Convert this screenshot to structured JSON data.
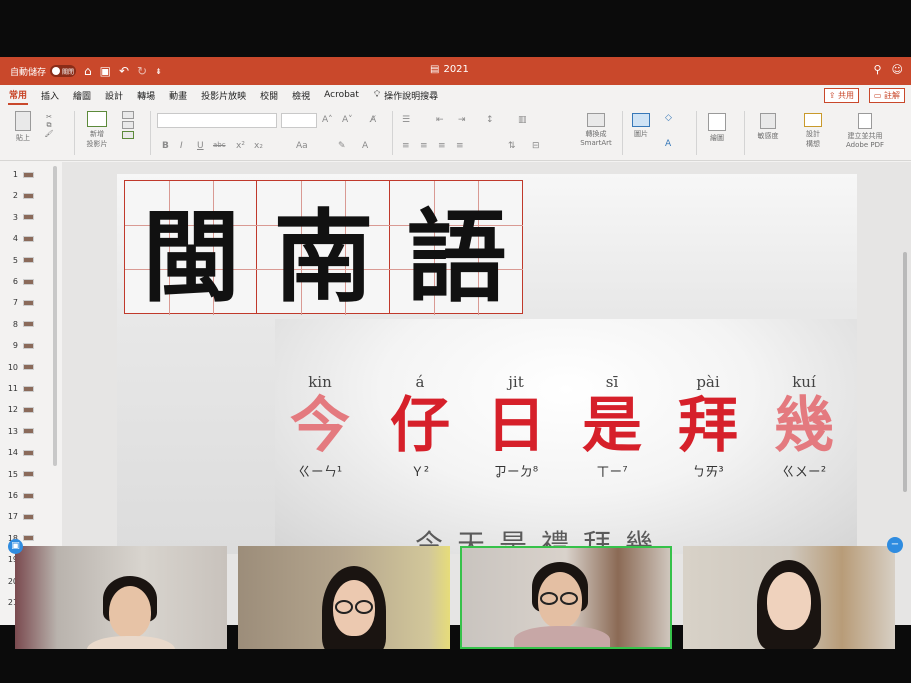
{
  "titlebar": {
    "autosave_label": "自動儲存",
    "autosave_state": "關閉",
    "doc_title": "2021",
    "icons": [
      "home-icon",
      "save-icon",
      "undo-icon",
      "redo-icon",
      "customize-icon",
      "search-icon",
      "person-icon"
    ]
  },
  "menu": {
    "tabs": [
      "常用",
      "插入",
      "繪圖",
      "設計",
      "轉場",
      "動畫",
      "投影片放映",
      "校閱",
      "檢視",
      "Acrobat"
    ],
    "active_tab": "常用",
    "tell_me": "操作說明搜尋",
    "share_label": "共用",
    "comment_label": "註解"
  },
  "ribbon": {
    "paste_label": "貼上",
    "new_slide_label_1": "新增",
    "new_slide_label_2": "投影片",
    "format_buttons": [
      "B",
      "I",
      "U",
      "abc",
      "x²",
      "x₂",
      "Aa"
    ],
    "smartart_label_1": "轉換成",
    "smartart_label_2": "SmartArt",
    "picture_label": "圖片",
    "drawing_label": "繪圖",
    "sensitivity_label": "敏感度",
    "designer_label_1": "設計",
    "designer_label_2": "構想",
    "pdf_label_1": "建立並共用",
    "pdf_label_2": "Adobe PDF"
  },
  "thumbnails": {
    "numbers": [
      "1",
      "2",
      "3",
      "4",
      "5",
      "6",
      "7",
      "8",
      "9",
      "10",
      "11",
      "12",
      "13",
      "14",
      "15",
      "16",
      "17",
      "18",
      "19",
      "20",
      "21"
    ]
  },
  "slide": {
    "title_chars": [
      "閩",
      "南",
      "語"
    ],
    "phrase": [
      {
        "pinyin": "kin",
        "hanzi": "今",
        "zhuyin": "ㄍㄧㄣ¹",
        "faded": true
      },
      {
        "pinyin": "á",
        "hanzi": "仔",
        "zhuyin": "Ｙ²",
        "faded": false
      },
      {
        "pinyin": "jit",
        "hanzi": "日",
        "zhuyin": "ㆡㄧㄉ⁸",
        "faded": false
      },
      {
        "pinyin": "sī",
        "hanzi": "是",
        "zhuyin": "ㄒㄧ⁷",
        "faded": false
      },
      {
        "pinyin": "pài",
        "hanzi": "拜",
        "zhuyin": "ㄅㄞ³",
        "faded": false
      },
      {
        "pinyin": "kuí",
        "hanzi": "幾",
        "zhuyin": "ㄍㄨㄧ²",
        "faded": true
      }
    ],
    "subtitle": "今天是禮拜幾"
  },
  "video": {
    "participants": 4,
    "active_index": 2
  },
  "colors": {
    "brand": "#c9482b",
    "accent_red": "#d6202a",
    "active_speaker": "#36c24a"
  }
}
